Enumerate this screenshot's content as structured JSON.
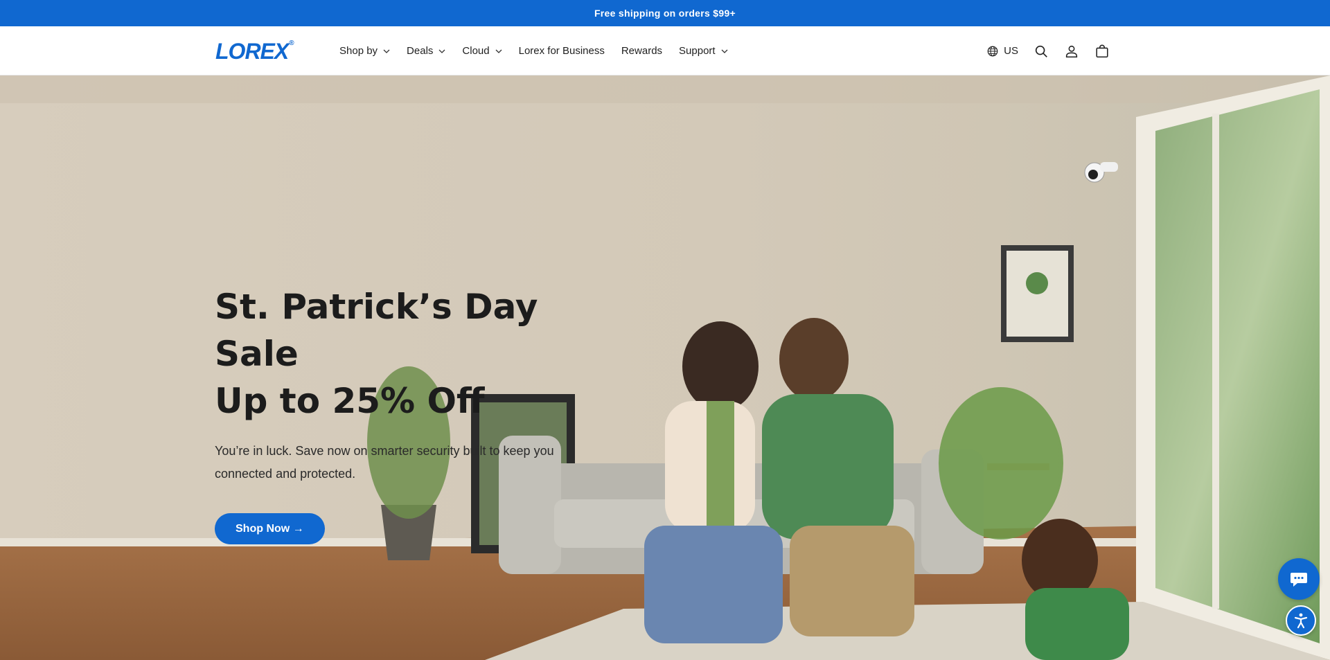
{
  "announcement": {
    "text": "Free shipping on orders $99+"
  },
  "brand": {
    "logo_text": "LOREX",
    "registered": "®",
    "color": "#1068d0"
  },
  "nav": {
    "items": [
      {
        "label": "Shop by",
        "has_menu": true
      },
      {
        "label": "Deals",
        "has_menu": true
      },
      {
        "label": "Cloud",
        "has_menu": true
      },
      {
        "label": "Lorex for Business",
        "has_menu": false
      },
      {
        "label": "Rewards",
        "has_menu": false
      },
      {
        "label": "Support",
        "has_menu": true
      }
    ]
  },
  "utility": {
    "locale": "US",
    "icons": [
      "globe-icon",
      "search-icon",
      "account-icon",
      "cart-icon"
    ]
  },
  "hero": {
    "title_line1": "St. Patrick’s Day Sale",
    "title_line2": "Up to 25% Off",
    "subtitle": "You’re in luck. Save now on smarter security built to keep you connected and protected.",
    "cta_label": "Shop Now →"
  },
  "widgets": {
    "chat": "chat-icon",
    "accessibility": "accessibility-icon"
  }
}
